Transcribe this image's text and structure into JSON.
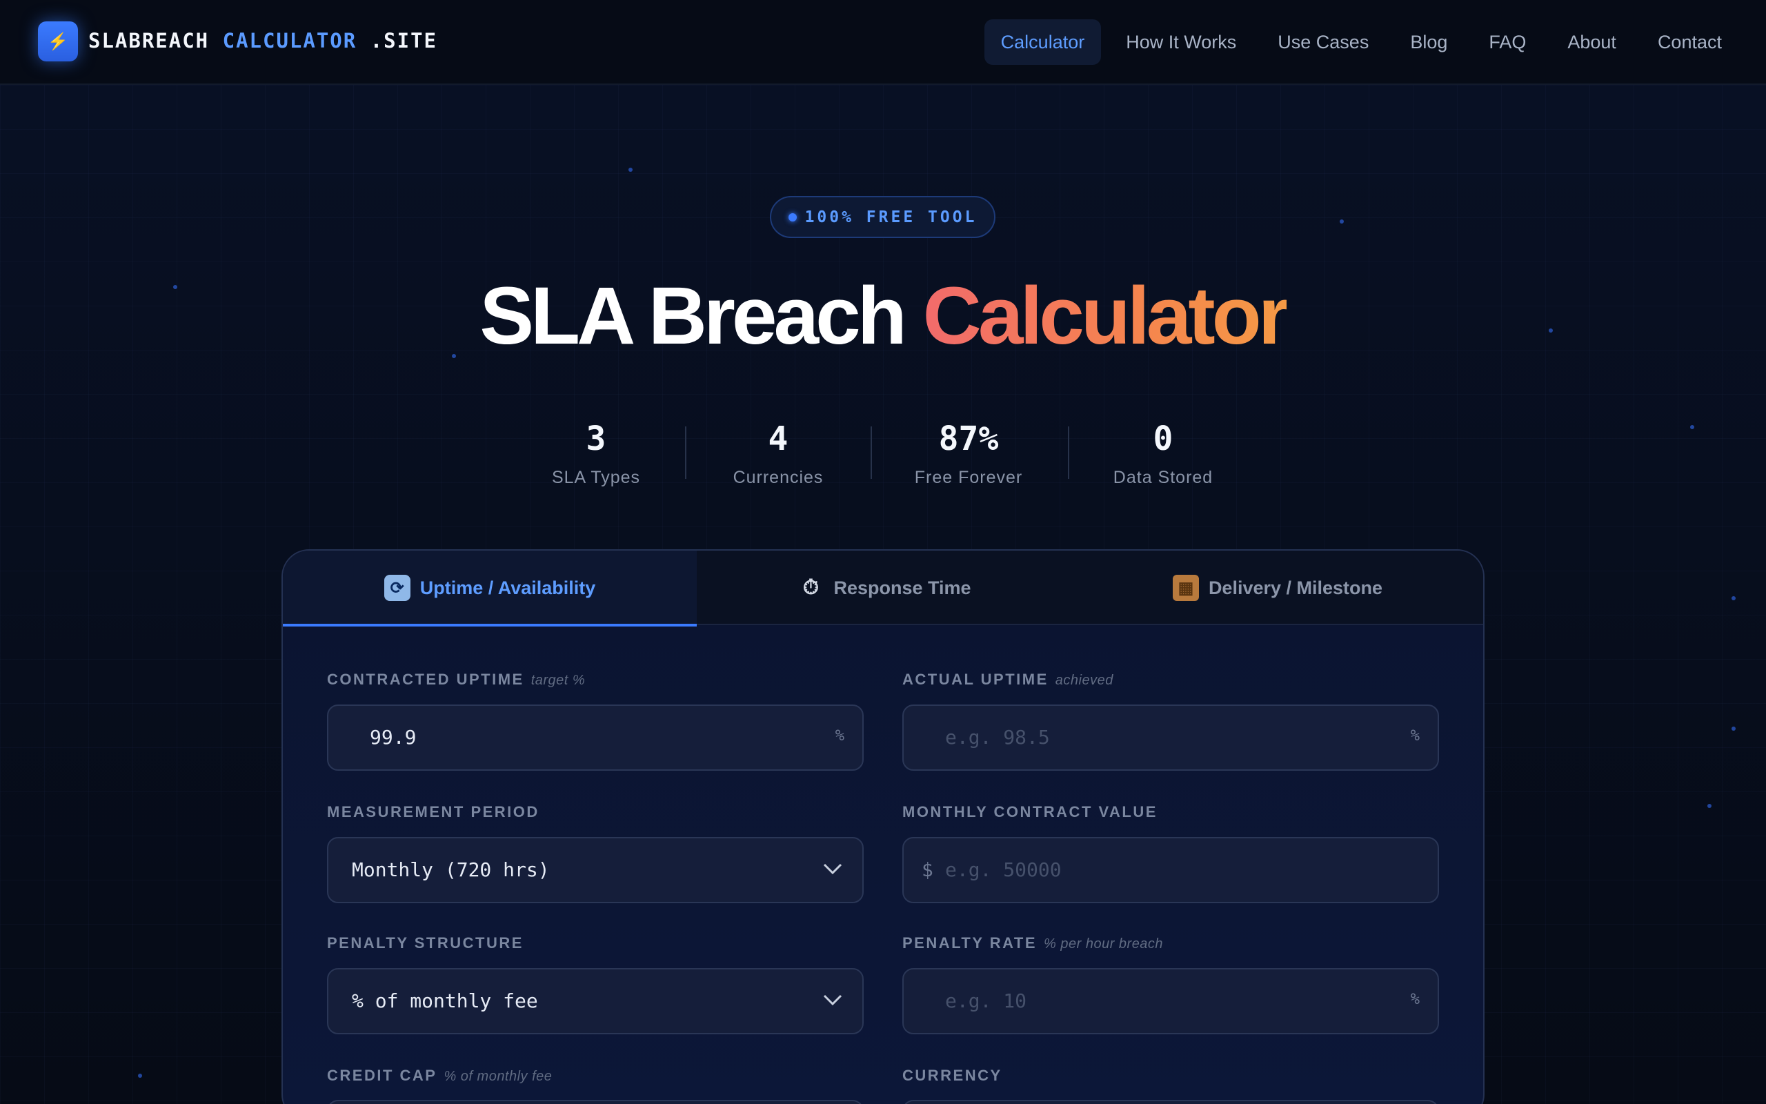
{
  "header": {
    "logo_icon": "⚡",
    "brand_part1": "SLABREACH",
    "brand_part2": "CALCULATOR",
    "brand_part3": ".SITE",
    "nav": [
      "Calculator",
      "How It Works",
      "Use Cases",
      "Blog",
      "FAQ",
      "About",
      "Contact"
    ],
    "active_nav": "Calculator"
  },
  "hero": {
    "badge": "100% FREE TOOL",
    "title_main": "SLA Breach",
    "title_accent": "Calculator",
    "stats": [
      {
        "value": "3",
        "label": "SLA Types"
      },
      {
        "value": "4",
        "label": "Currencies"
      },
      {
        "value": "87%",
        "label": "Free Forever"
      },
      {
        "value": "0",
        "label": "Data Stored"
      }
    ]
  },
  "calculator": {
    "tabs": [
      {
        "icon": "sync-icon",
        "glyph": "🔄",
        "label": "Uptime / Availability",
        "active": true
      },
      {
        "icon": "stopwatch-icon",
        "glyph": "⏱",
        "label": "Response Time",
        "active": false
      },
      {
        "icon": "package-icon",
        "glyph": "📦",
        "label": "Delivery / Milestone",
        "active": false
      }
    ],
    "fields": {
      "contracted_uptime": {
        "label": "CONTRACTED UPTIME",
        "hint": "target %",
        "value": "99.9",
        "suffix": "%"
      },
      "actual_uptime": {
        "label": "ACTUAL UPTIME",
        "hint": "achieved",
        "placeholder": "e.g. 98.5",
        "suffix": "%"
      },
      "measurement_period": {
        "label": "MEASUREMENT PERIOD",
        "value": "Monthly (720 hrs)"
      },
      "monthly_contract_value": {
        "label": "MONTHLY CONTRACT VALUE",
        "prefix": "$",
        "placeholder": "e.g. 50000"
      },
      "penalty_structure": {
        "label": "PENALTY STRUCTURE",
        "value": "% of monthly fee"
      },
      "penalty_rate": {
        "label": "PENALTY RATE",
        "hint": "% per hour breach",
        "placeholder": "e.g. 10",
        "suffix": "%"
      },
      "credit_cap": {
        "label": "CREDIT CAP",
        "hint": "% of monthly fee"
      },
      "currency": {
        "label": "CURRENCY"
      }
    }
  },
  "colors": {
    "accent": "#3b7bff",
    "accent_text": "#5e9dff",
    "title_gradient_start": "#f26b6b",
    "title_gradient_end": "#f59a45",
    "background": "#060b16"
  }
}
